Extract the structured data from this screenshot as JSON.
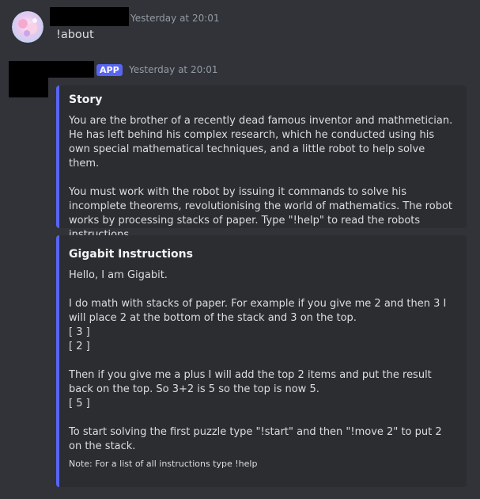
{
  "messages": [
    {
      "timestamp": "Yesterday at 20:01",
      "content": "!about"
    },
    {
      "badge": "APP",
      "timestamp": "Yesterday at 20:01",
      "embeds": [
        {
          "title": "Story",
          "paragraphs": [
            "You are the brother of a recently dead famous inventor and mathmetician. He has left behind his complex research, which he conducted using his own special mathematical techniques, and a little robot to help solve them.",
            "You must work with the robot by issuing it commands to solve his incomplete theorems, revolutionising the world of mathematics. The robot works by processing stacks of paper. Type \"!help\" to read the robots instructions."
          ]
        },
        {
          "title": "Gigabit Instructions",
          "paragraphs": [
            "Hello, I am Gigabit.",
            "I do math with stacks of paper. For example if you give me 2 and then 3 I will place 2 at the bottom of the stack and 3 on the top.",
            "[ 3 ]",
            "[ 2 ]",
            "Then if you give me a plus I will add the top 2 items and put the result back on the top. So 3+2 is 5 so the top is now 5.",
            "[ 5 ]",
            "To start solving the first puzzle type \"!start\" and then \"!move 2\" to put 2 on the stack."
          ],
          "footer": "Note: For a list of all instructions type !help"
        }
      ]
    }
  ],
  "colors": {
    "background": "#313338",
    "embed_background": "#2b2d31",
    "embed_accent": "#5865f2",
    "app_badge": "#5865f2",
    "timestamp": "#949ba4"
  }
}
